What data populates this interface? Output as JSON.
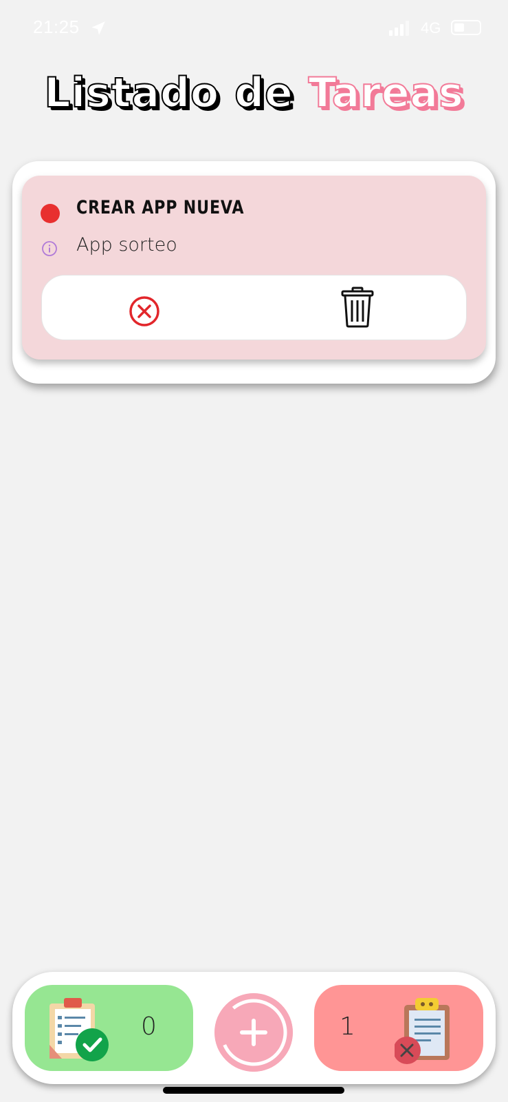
{
  "status_bar": {
    "time": "21:25",
    "network": "4G"
  },
  "header": {
    "title_part1": "Listado de",
    "title_part2": "Tareas"
  },
  "tasks": [
    {
      "title": "CREAR APP NUEVA",
      "description": "App sorteo",
      "status_color": "#e8302f"
    }
  ],
  "bottom_bar": {
    "completed_count": "0",
    "pending_count": "1"
  },
  "colors": {
    "accent_pink": "#f27a98",
    "card_bg": "#f4d7da",
    "done_green": "#96e692",
    "pending_red": "#ff9595"
  }
}
